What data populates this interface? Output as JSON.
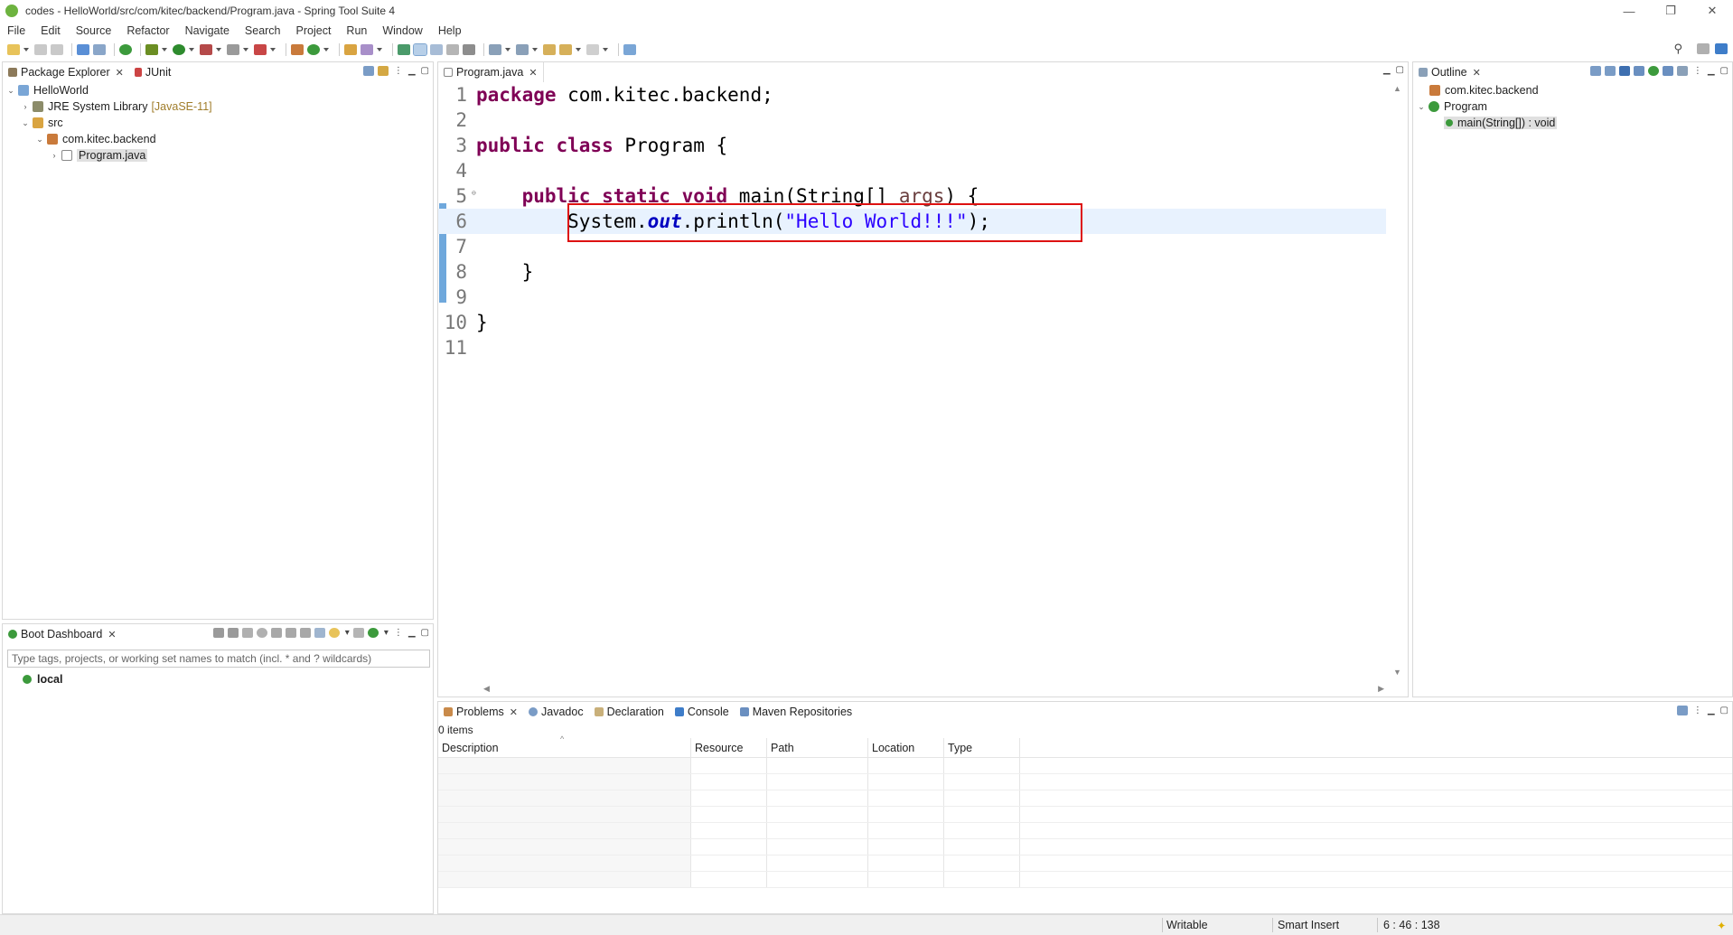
{
  "window": {
    "title": "codes - HelloWorld/src/com/kitec/backend/Program.java - Spring Tool Suite 4",
    "minimize": "—",
    "restore": "❐",
    "close": "✕"
  },
  "menu": [
    "File",
    "Edit",
    "Source",
    "Refactor",
    "Navigate",
    "Search",
    "Project",
    "Run",
    "Window",
    "Help"
  ],
  "package_explorer": {
    "tabs": [
      "Package Explorer",
      "JUnit"
    ],
    "tree": {
      "project": "HelloWorld",
      "jre": "JRE System Library",
      "jre_decor": "[JavaSE-11]",
      "src": "src",
      "package": "com.kitec.backend",
      "file": "Program.java"
    }
  },
  "boot_dashboard": {
    "tab": "Boot Dashboard",
    "filter_placeholder": "Type tags, projects, or working set names to match (incl. * and ? wildcards)",
    "items": [
      "local"
    ]
  },
  "editor": {
    "tab": "Program.java",
    "line_numbers": [
      "1",
      "2",
      "3",
      "4",
      "5",
      "6",
      "7",
      "8",
      "9",
      "10",
      "11"
    ],
    "code": {
      "l1_kw": "package",
      "l1_rest": " com.kitec.backend;",
      "l3_kw": "public class",
      "l3_rest": " Program {",
      "l5_indent": "    ",
      "l5_kw": "public static void",
      "l5_mid": " main(String[] ",
      "l5_param": "args",
      "l5_end": ") {",
      "l6_indent": "        ",
      "l6_pre": "System.",
      "l6_field": "out",
      "l6_mid": ".println(",
      "l6_str": "\"Hello World!!!\"",
      "l6_end": ");",
      "l8": "    }",
      "l10": "}"
    },
    "current_line": 6
  },
  "outline": {
    "tab": "Outline",
    "package": "com.kitec.backend",
    "class": "Program",
    "method": "main(String[]) : void"
  },
  "problems": {
    "tabs": [
      "Problems",
      "Javadoc",
      "Declaration",
      "Console",
      "Maven Repositories"
    ],
    "count": "0 items",
    "columns": [
      "Description",
      "Resource",
      "Path",
      "Location",
      "Type"
    ]
  },
  "status_bar": {
    "writable": "Writable",
    "insert_mode": "Smart Insert",
    "position": "6 : 46 : 138"
  },
  "colors": {
    "keyword": "#7f0055",
    "string": "#2a00ff",
    "field": "#0000c0",
    "highlight_box": "#dd1111",
    "current_line": "#e8f2fe"
  }
}
